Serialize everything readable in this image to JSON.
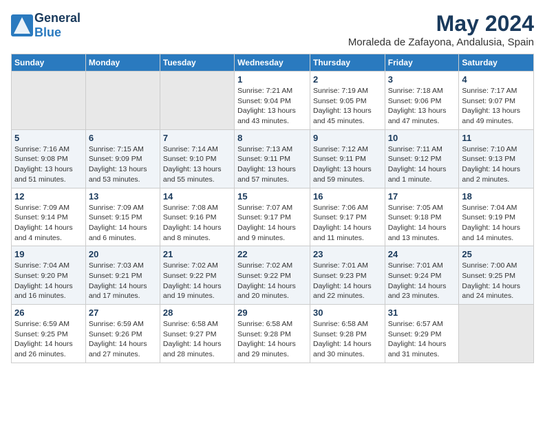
{
  "logo": {
    "general": "General",
    "blue": "Blue"
  },
  "header": {
    "title": "May 2024",
    "subtitle": "Moraleda de Zafayona, Andalusia, Spain"
  },
  "weekdays": [
    "Sunday",
    "Monday",
    "Tuesday",
    "Wednesday",
    "Thursday",
    "Friday",
    "Saturday"
  ],
  "weeks": [
    [
      {
        "day": "",
        "info": ""
      },
      {
        "day": "",
        "info": ""
      },
      {
        "day": "",
        "info": ""
      },
      {
        "day": "1",
        "info": "Sunrise: 7:21 AM\nSunset: 9:04 PM\nDaylight: 13 hours\nand 43 minutes."
      },
      {
        "day": "2",
        "info": "Sunrise: 7:19 AM\nSunset: 9:05 PM\nDaylight: 13 hours\nand 45 minutes."
      },
      {
        "day": "3",
        "info": "Sunrise: 7:18 AM\nSunset: 9:06 PM\nDaylight: 13 hours\nand 47 minutes."
      },
      {
        "day": "4",
        "info": "Sunrise: 7:17 AM\nSunset: 9:07 PM\nDaylight: 13 hours\nand 49 minutes."
      }
    ],
    [
      {
        "day": "5",
        "info": "Sunrise: 7:16 AM\nSunset: 9:08 PM\nDaylight: 13 hours\nand 51 minutes."
      },
      {
        "day": "6",
        "info": "Sunrise: 7:15 AM\nSunset: 9:09 PM\nDaylight: 13 hours\nand 53 minutes."
      },
      {
        "day": "7",
        "info": "Sunrise: 7:14 AM\nSunset: 9:10 PM\nDaylight: 13 hours\nand 55 minutes."
      },
      {
        "day": "8",
        "info": "Sunrise: 7:13 AM\nSunset: 9:11 PM\nDaylight: 13 hours\nand 57 minutes."
      },
      {
        "day": "9",
        "info": "Sunrise: 7:12 AM\nSunset: 9:11 PM\nDaylight: 13 hours\nand 59 minutes."
      },
      {
        "day": "10",
        "info": "Sunrise: 7:11 AM\nSunset: 9:12 PM\nDaylight: 14 hours\nand 1 minute."
      },
      {
        "day": "11",
        "info": "Sunrise: 7:10 AM\nSunset: 9:13 PM\nDaylight: 14 hours\nand 2 minutes."
      }
    ],
    [
      {
        "day": "12",
        "info": "Sunrise: 7:09 AM\nSunset: 9:14 PM\nDaylight: 14 hours\nand 4 minutes."
      },
      {
        "day": "13",
        "info": "Sunrise: 7:09 AM\nSunset: 9:15 PM\nDaylight: 14 hours\nand 6 minutes."
      },
      {
        "day": "14",
        "info": "Sunrise: 7:08 AM\nSunset: 9:16 PM\nDaylight: 14 hours\nand 8 minutes."
      },
      {
        "day": "15",
        "info": "Sunrise: 7:07 AM\nSunset: 9:17 PM\nDaylight: 14 hours\nand 9 minutes."
      },
      {
        "day": "16",
        "info": "Sunrise: 7:06 AM\nSunset: 9:17 PM\nDaylight: 14 hours\nand 11 minutes."
      },
      {
        "day": "17",
        "info": "Sunrise: 7:05 AM\nSunset: 9:18 PM\nDaylight: 14 hours\nand 13 minutes."
      },
      {
        "day": "18",
        "info": "Sunrise: 7:04 AM\nSunset: 9:19 PM\nDaylight: 14 hours\nand 14 minutes."
      }
    ],
    [
      {
        "day": "19",
        "info": "Sunrise: 7:04 AM\nSunset: 9:20 PM\nDaylight: 14 hours\nand 16 minutes."
      },
      {
        "day": "20",
        "info": "Sunrise: 7:03 AM\nSunset: 9:21 PM\nDaylight: 14 hours\nand 17 minutes."
      },
      {
        "day": "21",
        "info": "Sunrise: 7:02 AM\nSunset: 9:22 PM\nDaylight: 14 hours\nand 19 minutes."
      },
      {
        "day": "22",
        "info": "Sunrise: 7:02 AM\nSunset: 9:22 PM\nDaylight: 14 hours\nand 20 minutes."
      },
      {
        "day": "23",
        "info": "Sunrise: 7:01 AM\nSunset: 9:23 PM\nDaylight: 14 hours\nand 22 minutes."
      },
      {
        "day": "24",
        "info": "Sunrise: 7:01 AM\nSunset: 9:24 PM\nDaylight: 14 hours\nand 23 minutes."
      },
      {
        "day": "25",
        "info": "Sunrise: 7:00 AM\nSunset: 9:25 PM\nDaylight: 14 hours\nand 24 minutes."
      }
    ],
    [
      {
        "day": "26",
        "info": "Sunrise: 6:59 AM\nSunset: 9:25 PM\nDaylight: 14 hours\nand 26 minutes."
      },
      {
        "day": "27",
        "info": "Sunrise: 6:59 AM\nSunset: 9:26 PM\nDaylight: 14 hours\nand 27 minutes."
      },
      {
        "day": "28",
        "info": "Sunrise: 6:58 AM\nSunset: 9:27 PM\nDaylight: 14 hours\nand 28 minutes."
      },
      {
        "day": "29",
        "info": "Sunrise: 6:58 AM\nSunset: 9:28 PM\nDaylight: 14 hours\nand 29 minutes."
      },
      {
        "day": "30",
        "info": "Sunrise: 6:58 AM\nSunset: 9:28 PM\nDaylight: 14 hours\nand 30 minutes."
      },
      {
        "day": "31",
        "info": "Sunrise: 6:57 AM\nSunset: 9:29 PM\nDaylight: 14 hours\nand 31 minutes."
      },
      {
        "day": "",
        "info": ""
      }
    ]
  ]
}
